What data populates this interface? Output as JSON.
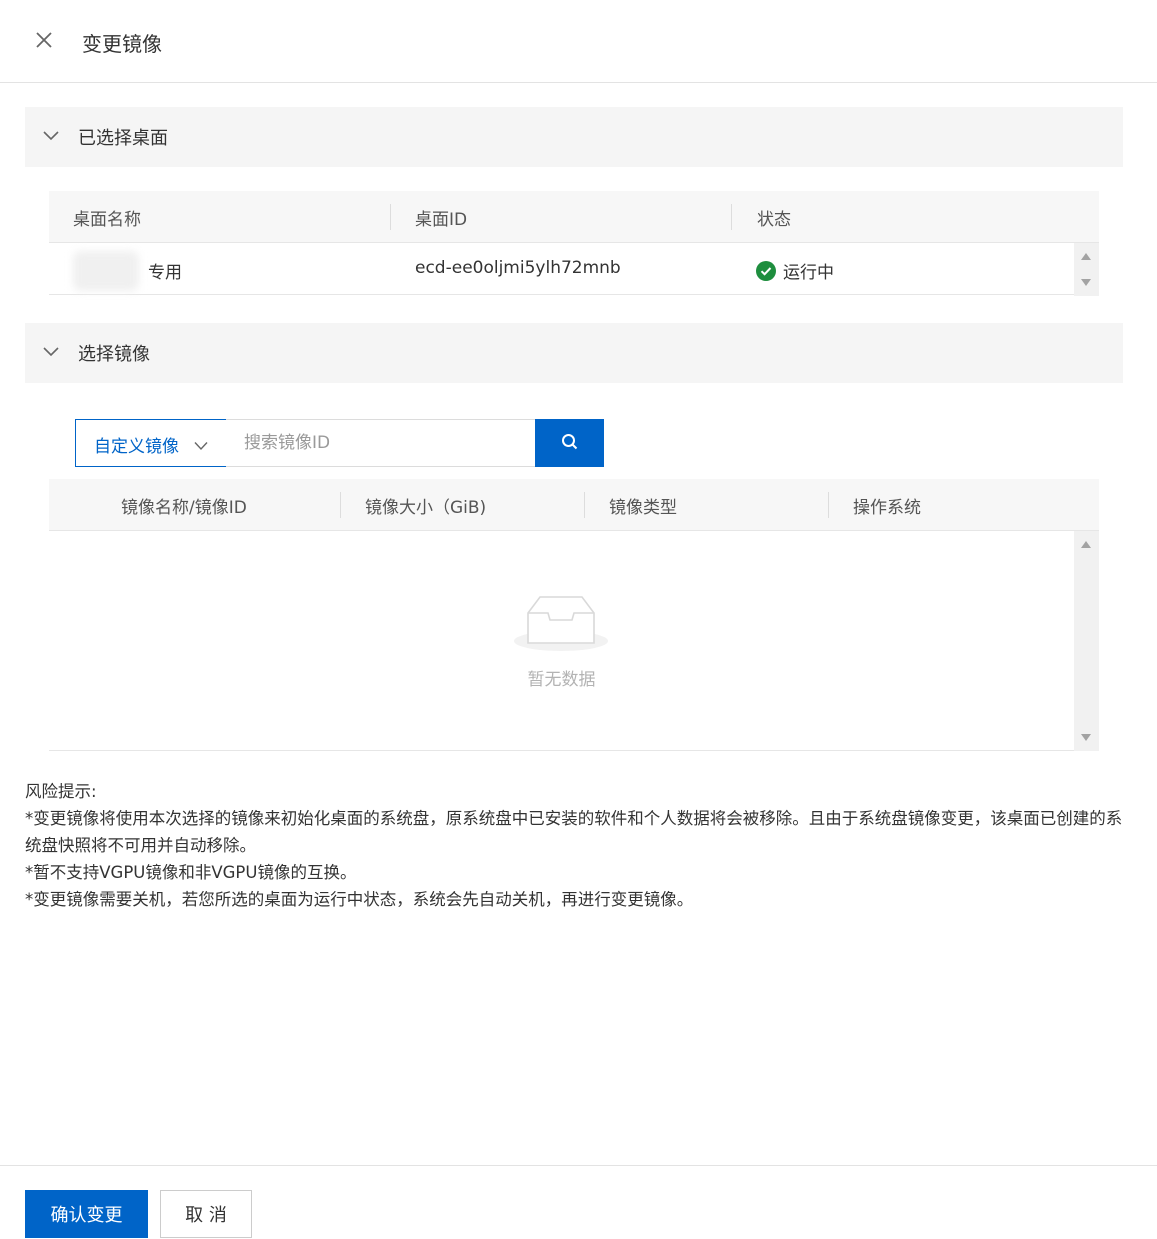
{
  "drawer": {
    "title": "变更镜像",
    "close_icon": "close-icon"
  },
  "selected_desktops": {
    "section_label": "已选择桌面",
    "columns": [
      "桌面名称",
      "桌面ID",
      "状态"
    ],
    "rows": [
      {
        "name": "专用",
        "id": "ecd-ee0oljmi5ylh72mnb",
        "status": "运行中",
        "status_color": "#1e8e3e"
      }
    ]
  },
  "select_image": {
    "section_label": "选择镜像",
    "image_type": "自定义镜像",
    "search_placeholder": "搜索镜像ID",
    "search_icon": "search-icon",
    "columns": [
      "镜像名称/镜像ID",
      "镜像大小（GiB)",
      "镜像类型",
      "操作系统"
    ],
    "empty_text": "暂无数据"
  },
  "risk": {
    "title": "风险提示:",
    "lines": [
      "*变更镜像将使用本次选择的镜像来初始化桌面的系统盘，原系统盘中已安装的软件和个人数据将会被移除。且由于系统盘镜像变更，该桌面已创建的系统盘快照将不可用并自动移除。",
      "*暂不支持VGPU镜像和非VGPU镜像的互换。",
      "*变更镜像需要关机，若您所选的桌面为运行中状态，系统会先自动关机，再进行变更镜像。"
    ]
  },
  "footer": {
    "confirm_label": "确认变更",
    "cancel_label": "取 消"
  },
  "colors": {
    "primary": "#0064c8",
    "section_bg": "#f5f5f5",
    "success": "#1e8e3e"
  }
}
